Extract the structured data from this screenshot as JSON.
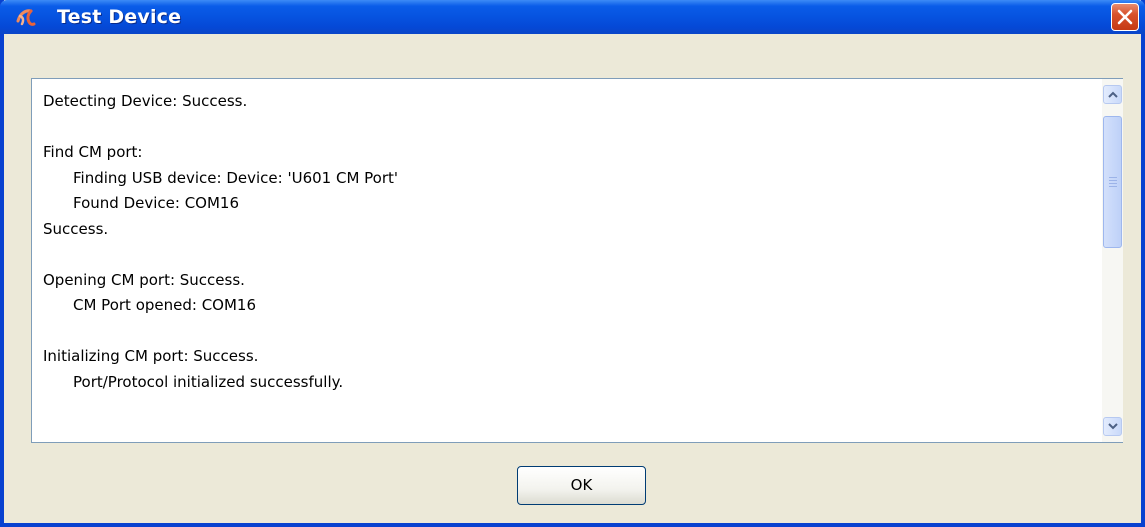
{
  "window": {
    "title": "Test Device",
    "title_icon": "app-swirl-icon",
    "close_icon": "close-icon",
    "accent_color": "#0a5ce8",
    "close_color": "#d8522c"
  },
  "log": {
    "lines": [
      {
        "text": "Detecting Device: Success.",
        "indent": false
      },
      {
        "text": "",
        "indent": false
      },
      {
        "text": "Find CM port:",
        "indent": false
      },
      {
        "text": "Finding USB device: Device: 'U601 CM Port'",
        "indent": true
      },
      {
        "text": "Found Device: COM16",
        "indent": true
      },
      {
        "text": "Success.",
        "indent": false
      },
      {
        "text": "",
        "indent": false
      },
      {
        "text": "Opening CM port: Success.",
        "indent": false
      },
      {
        "text": "CM Port opened: COM16",
        "indent": true
      },
      {
        "text": "",
        "indent": false
      },
      {
        "text": "Initializing CM port: Success.",
        "indent": false
      },
      {
        "text": "Port/Protocol initialized successfully.",
        "indent": true
      }
    ]
  },
  "scrollbar": {
    "up_icon": "chevron-up-icon",
    "down_icon": "chevron-down-icon"
  },
  "buttons": {
    "ok_label": "OK"
  }
}
